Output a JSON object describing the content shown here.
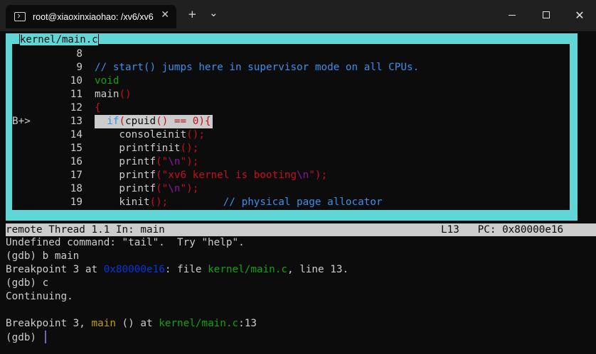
{
  "window": {
    "tab_title": "root@xiaoxinxiaohao: /xv6/xv6",
    "new_tab": "+",
    "dropdown": "⌄",
    "tab_close": "✕",
    "minimize": "",
    "maximize": "",
    "close": "✕"
  },
  "source": {
    "file_title": "kernel/main.c",
    "lines": [
      {
        "mark": "",
        "num": "8",
        "tokens": []
      },
      {
        "mark": "",
        "num": "9",
        "tokens": [
          {
            "t": "// start() jumps here in supervisor mode on all CPUs.",
            "c": "blue"
          }
        ]
      },
      {
        "mark": "",
        "num": "10",
        "tokens": [
          {
            "t": "void",
            "c": "green"
          }
        ]
      },
      {
        "mark": "",
        "num": "11",
        "tokens": [
          {
            "t": "main",
            "c": "white"
          },
          {
            "t": "()",
            "c": "red"
          }
        ]
      },
      {
        "mark": "",
        "num": "12",
        "tokens": [
          {
            "t": "{",
            "c": "red"
          }
        ]
      },
      {
        "mark": "B+>",
        "num": "13",
        "tokens": [
          {
            "t": "  if",
            "c": "blue"
          },
          {
            "t": "(",
            "c": "red"
          },
          {
            "t": "cpuid",
            "c": "white"
          },
          {
            "t": "()",
            "c": "red"
          },
          {
            "t": " == ",
            "c": "red"
          },
          {
            "t": "0",
            "c": "red"
          },
          {
            "t": "){",
            "c": "red"
          }
        ],
        "highlight": true
      },
      {
        "mark": "",
        "num": "14",
        "tokens": [
          {
            "t": "    consoleinit",
            "c": "white"
          },
          {
            "t": "();",
            "c": "red"
          }
        ]
      },
      {
        "mark": "",
        "num": "15",
        "tokens": [
          {
            "t": "    printfinit",
            "c": "white"
          },
          {
            "t": "();",
            "c": "red"
          }
        ]
      },
      {
        "mark": "",
        "num": "16",
        "tokens": [
          {
            "t": "    printf",
            "c": "white"
          },
          {
            "t": "(\"",
            "c": "red"
          },
          {
            "t": "\\n",
            "c": "purple"
          },
          {
            "t": "\");",
            "c": "red"
          }
        ]
      },
      {
        "mark": "",
        "num": "17",
        "tokens": [
          {
            "t": "    printf",
            "c": "white"
          },
          {
            "t": "(\"xv6 kernel is booting",
            "c": "red"
          },
          {
            "t": "\\n",
            "c": "purple"
          },
          {
            "t": "\");",
            "c": "red"
          }
        ]
      },
      {
        "mark": "",
        "num": "18",
        "tokens": [
          {
            "t": "    printf",
            "c": "white"
          },
          {
            "t": "(\"",
            "c": "red"
          },
          {
            "t": "\\n",
            "c": "purple"
          },
          {
            "t": "\");",
            "c": "red"
          }
        ]
      },
      {
        "mark": "",
        "num": "19",
        "tokens": [
          {
            "t": "    kinit",
            "c": "white"
          },
          {
            "t": "();",
            "c": "red"
          },
          {
            "t": "         ",
            "c": "white"
          },
          {
            "t": "// physical page allocator",
            "c": "blue"
          }
        ]
      }
    ]
  },
  "status": {
    "left": "remote Thread 1.1 In: main",
    "right": "L13   PC: 0x80000e16"
  },
  "console": {
    "lines": [
      [
        {
          "t": "Undefined command: \"tail\".  Try \"help\".",
          "c": "white"
        }
      ],
      [
        {
          "t": "(gdb) b main",
          "c": "white"
        }
      ],
      [
        {
          "t": "Breakpoint 3 at ",
          "c": "white"
        },
        {
          "t": "0x80000e16",
          "c": "darkblue"
        },
        {
          "t": ": file ",
          "c": "white"
        },
        {
          "t": "kernel/main.c",
          "c": "green"
        },
        {
          "t": ", line 13.",
          "c": "white"
        }
      ],
      [
        {
          "t": "(gdb) c",
          "c": "white"
        }
      ],
      [
        {
          "t": "Continuing.",
          "c": "white"
        }
      ],
      [],
      [
        {
          "t": "Breakpoint 3, ",
          "c": "white"
        },
        {
          "t": "main",
          "c": "yellow"
        },
        {
          "t": " () at ",
          "c": "white"
        },
        {
          "t": "kernel/main.c",
          "c": "green"
        },
        {
          "t": ":13",
          "c": "white"
        }
      ],
      [
        {
          "t": "(gdb) ",
          "c": "white"
        }
      ]
    ]
  }
}
